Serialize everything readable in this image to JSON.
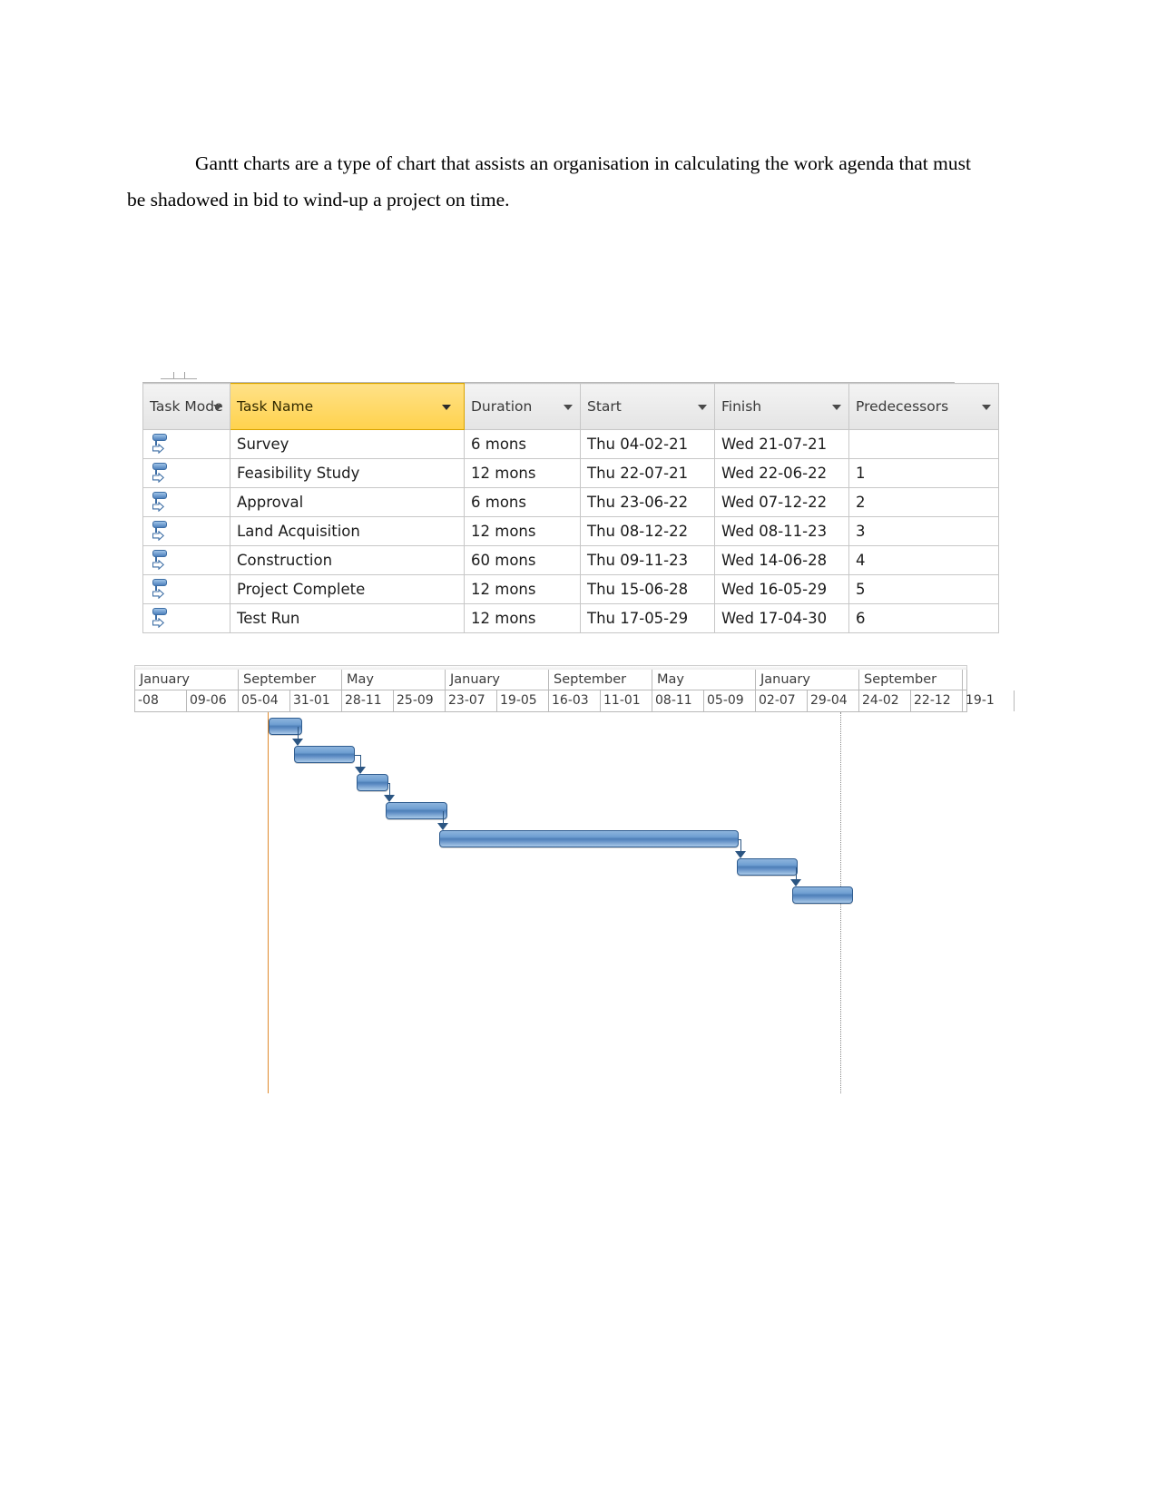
{
  "document": {
    "paragraph": "Gantt charts are a type of chart that assists an organisation in calculating the work agenda that must be shadowed in bid to wind-up a project on time."
  },
  "task_table": {
    "columns": [
      {
        "key": "mode",
        "label": "Task Mode",
        "highlighted": false
      },
      {
        "key": "name",
        "label": "Task Name",
        "highlighted": true
      },
      {
        "key": "duration",
        "label": "Duration",
        "highlighted": false
      },
      {
        "key": "start",
        "label": "Start",
        "highlighted": false
      },
      {
        "key": "finish",
        "label": "Finish",
        "highlighted": false
      },
      {
        "key": "predecessors",
        "label": "Predecessors",
        "highlighted": false
      }
    ],
    "highlight_color": "#ffd24d",
    "rows": [
      {
        "mode_icon": "manual-schedule-icon",
        "name": "Survey",
        "duration": "6 mons",
        "start": "Thu 04-02-21",
        "finish": "Wed 21-07-21",
        "predecessors": ""
      },
      {
        "mode_icon": "manual-schedule-icon",
        "name": "Feasibility Study",
        "duration": "12 mons",
        "start": "Thu 22-07-21",
        "finish": "Wed 22-06-22",
        "predecessors": "1"
      },
      {
        "mode_icon": "manual-schedule-icon",
        "name": "Approval",
        "duration": "6 mons",
        "start": "Thu 23-06-22",
        "finish": "Wed 07-12-22",
        "predecessors": "2"
      },
      {
        "mode_icon": "manual-schedule-icon",
        "name": "Land Acquisition",
        "duration": "12 mons",
        "start": "Thu 08-12-22",
        "finish": "Wed 08-11-23",
        "predecessors": "3"
      },
      {
        "mode_icon": "manual-schedule-icon",
        "name": "Construction",
        "duration": "60 mons",
        "start": "Thu 09-11-23",
        "finish": "Wed 14-06-28",
        "predecessors": "4"
      },
      {
        "mode_icon": "manual-schedule-icon",
        "name": "Project Complete",
        "duration": "12 mons",
        "start": "Thu 15-06-28",
        "finish": "Wed 16-05-29",
        "predecessors": "5"
      },
      {
        "mode_icon": "manual-schedule-icon",
        "name": "Test Run",
        "duration": "12 mons",
        "start": "Thu 17-05-29",
        "finish": "Wed 17-04-30",
        "predecessors": "6"
      }
    ]
  },
  "chart_data": {
    "type": "bar",
    "chart_style": "gantt",
    "title": "",
    "xlabel": "",
    "ylabel": "",
    "timeline": {
      "month_labels": [
        "January",
        "September",
        "May",
        "January",
        "September",
        "May",
        "January",
        "September"
      ],
      "day_labels": [
        "-08",
        "09-06",
        "05-04",
        "31-01",
        "28-11",
        "25-09",
        "23-07",
        "19-05",
        "16-03",
        "11-01",
        "08-11",
        "05-09",
        "02-07",
        "29-04",
        "24-02",
        "22-12",
        "19-1"
      ]
    },
    "bar_color": "#4e7fb8",
    "today_line_color": "#e08a2e",
    "status_line_style": "dotted",
    "categories": [
      "Survey",
      "Feasibility Study",
      "Approval",
      "Land Acquisition",
      "Construction",
      "Project Complete",
      "Test Run"
    ],
    "tasks": [
      {
        "name": "Survey",
        "duration": "6 mons",
        "start": "Thu 04-02-21",
        "finish": "Wed 21-07-21",
        "bar_left_pct": 16.1,
        "bar_width_pct": 4.1,
        "row": 0
      },
      {
        "name": "Feasibility Study",
        "duration": "12 mons",
        "start": "Thu 22-07-21",
        "finish": "Wed 22-06-22",
        "bar_left_pct": 19.2,
        "bar_width_pct": 7.3,
        "row": 1
      },
      {
        "name": "Approval",
        "duration": "6 mons",
        "start": "Thu 23-06-22",
        "finish": "Wed 07-12-22",
        "bar_left_pct": 26.7,
        "bar_width_pct": 3.8,
        "row": 2
      },
      {
        "name": "Land Acquisition",
        "duration": "12 mons",
        "start": "Thu 08-12-22",
        "finish": "Wed 08-11-23",
        "bar_left_pct": 30.2,
        "bar_width_pct": 7.4,
        "row": 3
      },
      {
        "name": "Construction",
        "duration": "60 mons",
        "start": "Thu 09-11-23",
        "finish": "Wed 14-06-28",
        "bar_left_pct": 36.6,
        "bar_width_pct": 36.0,
        "row": 4
      },
      {
        "name": "Project Complete",
        "duration": "12 mons",
        "start": "Thu 15-06-28",
        "finish": "Wed 16-05-29",
        "bar_left_pct": 72.3,
        "bar_width_pct": 7.3,
        "row": 5
      },
      {
        "name": "Test Run",
        "duration": "12 mons",
        "start": "Thu 17-05-29",
        "finish": "Wed 17-04-30",
        "bar_left_pct": 79.0,
        "bar_width_pct": 7.3,
        "row": 6
      }
    ],
    "dependencies": [
      {
        "from": "Survey",
        "to": "Feasibility Study"
      },
      {
        "from": "Feasibility Study",
        "to": "Approval"
      },
      {
        "from": "Approval",
        "to": "Land Acquisition"
      },
      {
        "from": "Land Acquisition",
        "to": "Construction"
      },
      {
        "from": "Construction",
        "to": "Project Complete"
      },
      {
        "from": "Project Complete",
        "to": "Test Run"
      }
    ]
  }
}
